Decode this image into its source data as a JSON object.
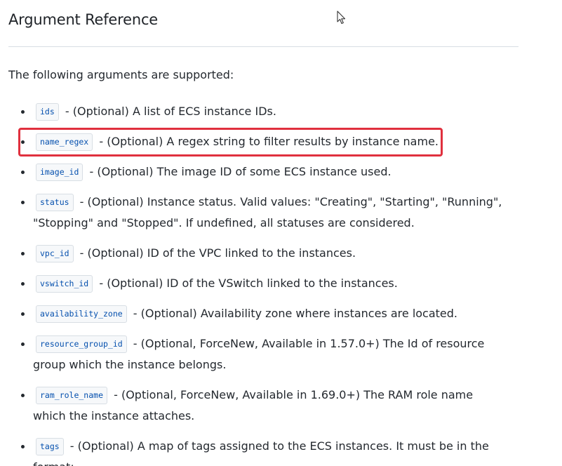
{
  "section": {
    "heading": "Argument Reference",
    "intro": "The following arguments are supported:"
  },
  "arguments": [
    {
      "name": "ids",
      "desc": "- (Optional) A list of ECS instance IDs."
    },
    {
      "name": "name_regex",
      "desc": "- (Optional) A regex string to filter results by instance name."
    },
    {
      "name": "image_id",
      "desc": "- (Optional) The image ID of some ECS instance used."
    },
    {
      "name": "status",
      "desc": "- (Optional) Instance status. Valid values: \"Creating\", \"Starting\", \"Running\", \"Stopping\" and \"Stopped\". If undefined, all statuses are considered."
    },
    {
      "name": "vpc_id",
      "desc": "- (Optional) ID of the VPC linked to the instances."
    },
    {
      "name": "vswitch_id",
      "desc": "- (Optional) ID of the VSwitch linked to the instances."
    },
    {
      "name": "availability_zone",
      "desc": "- (Optional) Availability zone where instances are located."
    },
    {
      "name": "resource_group_id",
      "desc": "- (Optional, ForceNew, Available in 1.57.0+) The Id of resource group which the instance belongs."
    },
    {
      "name": "ram_role_name",
      "desc": "- (Optional, ForceNew, Available in 1.69.0+) The RAM role name which the instance attaches."
    },
    {
      "name": "tags",
      "desc": "- (Optional) A map of tags assigned to the ECS instances. It must be in the format:"
    }
  ],
  "colors": {
    "highlight": "#e0303e",
    "code_text": "#0550ae"
  }
}
